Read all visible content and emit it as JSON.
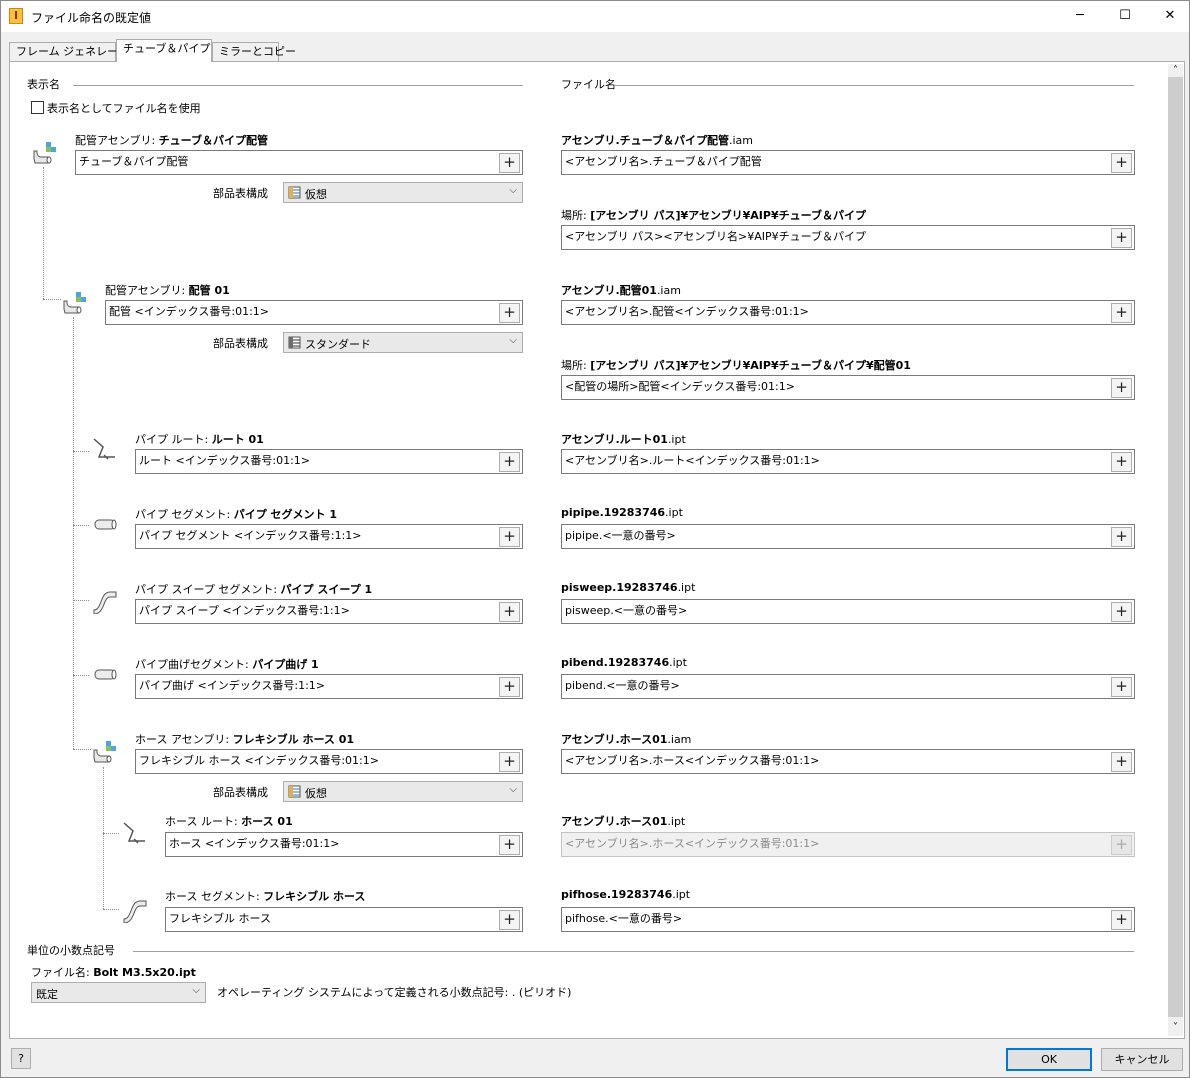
{
  "window": {
    "title": "ファイル命名の既定値",
    "app_icon_letter": "I",
    "minimize": "─",
    "maximize": "☐",
    "close": "✕"
  },
  "tabs": [
    "フレーム ジェネレータ",
    "チューブ＆パイプ",
    "ミラーとコピー"
  ],
  "display_name": {
    "heading": "表示名",
    "use_filename_checkbox": "表示名としてファイル名を使用",
    "bom_label": "部品表構成",
    "items": [
      {
        "prefix": "配管アセンブリ: ",
        "bold": "チューブ＆パイプ配管",
        "value": "チューブ＆パイプ配管",
        "bom": "仮想"
      },
      {
        "prefix": "配管アセンブリ: ",
        "bold": "配管 01",
        "value": "配管 <インデックス番号:01:1>",
        "bom": "スタンダード"
      },
      {
        "prefix": "パイプ ルート: ",
        "bold": "ルート 01",
        "value": "ルート <インデックス番号:01:1>"
      },
      {
        "prefix": "パイプ セグメント: ",
        "bold": "パイプ セグメント 1",
        "value": "パイプ セグメント <インデックス番号:1:1>"
      },
      {
        "prefix": "パイプ スイープ セグメント: ",
        "bold": "パイプ スイープ 1",
        "value": "パイプ スイープ <インデックス番号:1:1>"
      },
      {
        "prefix": "パイプ曲げセグメント: ",
        "bold": "パイプ曲げ 1",
        "value": "パイプ曲げ <インデックス番号:1:1>"
      },
      {
        "prefix": "ホース アセンブリ: ",
        "bold": "フレキシブル ホース 01",
        "value": "フレキシブル ホース <インデックス番号:01:1>",
        "bom": "仮想"
      },
      {
        "prefix": "ホース ルート: ",
        "bold": "ホース 01",
        "value": "ホース <インデックス番号:01:1>"
      },
      {
        "prefix": "ホース セグメント: ",
        "bold": "フレキシブル ホース",
        "value": "フレキシブル ホース"
      }
    ]
  },
  "file_name": {
    "heading": "ファイル名",
    "location_prefix": "場所: ",
    "items": [
      {
        "bold": "アセンブリ.チューブ＆パイプ配管",
        "ext": ".iam",
        "value": "<アセンブリ名>.チューブ＆パイプ配管",
        "loc_bold": "[アセンブリ パス]¥アセンブリ¥AIP¥チューブ＆パイプ",
        "loc_value": "<アセンブリ パス><アセンブリ名>¥AIP¥チューブ＆パイプ"
      },
      {
        "bold": "アセンブリ.配管01",
        "ext": ".iam",
        "value": "<アセンブリ名>.配管<インデックス番号:01:1>",
        "loc_bold": "[アセンブリ パス]¥アセンブリ¥AIP¥チューブ＆パイプ¥配管01",
        "loc_value": "<配管の場所>配管<インデックス番号:01:1>"
      },
      {
        "bold": "アセンブリ.ルート01",
        "ext": ".ipt",
        "value": "<アセンブリ名>.ルート<インデックス番号:01:1>"
      },
      {
        "bold": "pipipe.19283746",
        "ext": ".ipt",
        "value": "pipipe.<一意の番号>"
      },
      {
        "bold": "pisweep.19283746",
        "ext": ".ipt",
        "value": "pisweep.<一意の番号>"
      },
      {
        "bold": "pibend.19283746",
        "ext": ".ipt",
        "value": "pibend.<一意の番号>"
      },
      {
        "bold": "アセンブリ.ホース01",
        "ext": ".iam",
        "value": "<アセンブリ名>.ホース<インデックス番号:01:1>"
      },
      {
        "bold": "アセンブリ.ホース01",
        "ext": ".ipt",
        "value": "<アセンブリ名>.ホース<インデックス番号:01:1>"
      },
      {
        "bold": "pifhose.19283746",
        "ext": ".ipt",
        "value": "pifhose.<一意の番号>"
      }
    ]
  },
  "plus": "+",
  "decimal": {
    "heading": "単位の小数点記号",
    "filename_label": "ファイル名: ",
    "filename_value": "Bolt M3.5x20.ipt",
    "combo_value": "既定",
    "note": "オペレーティング システムによって定義される小数点記号: . (ピリオド)"
  },
  "buttons": {
    "help": "?",
    "ok": "OK",
    "cancel": "キャンセル"
  },
  "scroll_up": "˄",
  "scroll_down": "˅",
  "dropdown_arrow": "⌵"
}
